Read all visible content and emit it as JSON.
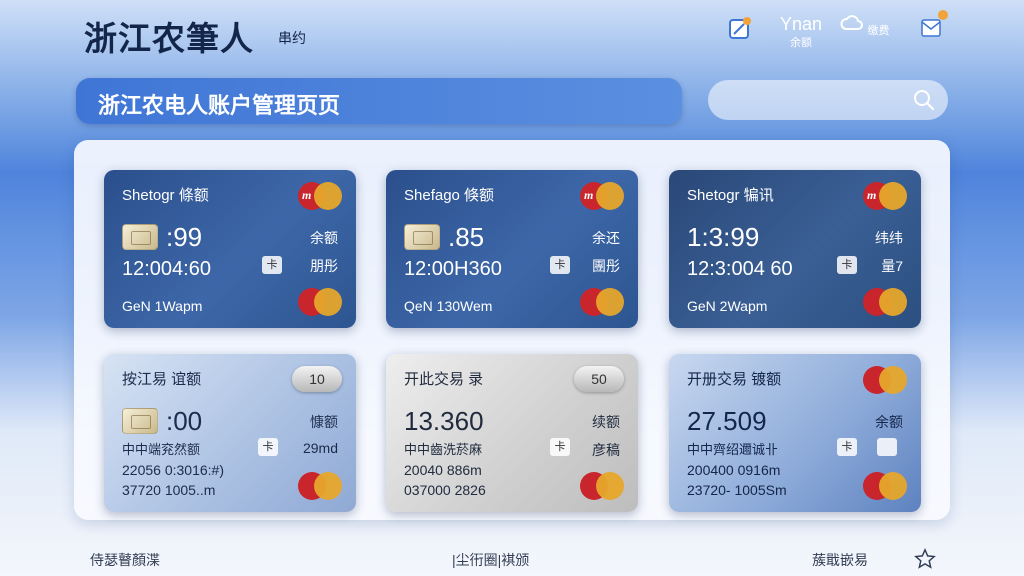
{
  "header": {
    "brand": "浙江农筆人",
    "brand_sub": "串约",
    "icons": [
      {
        "name": "account-icon",
        "label": ""
      },
      {
        "name": "user-icon",
        "label": "Ynan 余额"
      },
      {
        "name": "cloud-icon",
        "label": "缴费"
      },
      {
        "name": "message-icon",
        "label": ""
      }
    ]
  },
  "title_bar": {
    "title": "浙江农电人账户管理页页"
  },
  "search": {
    "placeholder": "",
    "value": ""
  },
  "cards": [
    {
      "title": "Shetogr 條额",
      "amount": ":99",
      "line2": "12:004:60",
      "line3": "GeN 1Wapm",
      "label1": "余额",
      "label2": "朋彤",
      "tag": "卡"
    },
    {
      "title": "Shefago 倏额",
      "amount": ".85",
      "line2": "12:00H360",
      "line3": "QeN 130Wem",
      "label1": "余还",
      "label2": "團彤",
      "tag": "卡"
    },
    {
      "title": "Shetogr 犏讯",
      "amount": "1:3:99",
      "line2": "12:3:004 60",
      "line3": "GeN 2Wapm",
      "label1": "纬纬",
      "label2": "量7",
      "tag": "卡"
    },
    {
      "title": "按江易 谊额",
      "badge": "10",
      "amount": ":00",
      "sub": "中中端兖然额",
      "l4": "22056 0:3016:#)",
      "l5": "37720 1005..m",
      "label1": "慷额",
      "label2": "29md",
      "tag": "卡"
    },
    {
      "title": "开此交易 录",
      "badge": "50",
      "amount": "13.360",
      "sub": "中中齒洗菸麻",
      "l4": "20040 886m",
      "l5": "037000 2826",
      "label1": "续额",
      "label2": "彦稿",
      "tag": "卡"
    },
    {
      "title": "开册交易 镀额",
      "amount": "27.509",
      "sub": "中中齊绍邇诚卝",
      "l4": "200400 0916m",
      "l5": "23720- 1005Sm",
      "label1": "余额",
      "label2": "",
      "tag": "卡"
    }
  ],
  "footer": {
    "left": "侍瑟瞽顏渫",
    "center": "|尘衎圈|褀颁",
    "right": "蔟戢嵌易"
  },
  "colors": {
    "accent": "#3f76d6",
    "mc_red": "#c9252c",
    "mc_yellow": "#e6a62b"
  }
}
